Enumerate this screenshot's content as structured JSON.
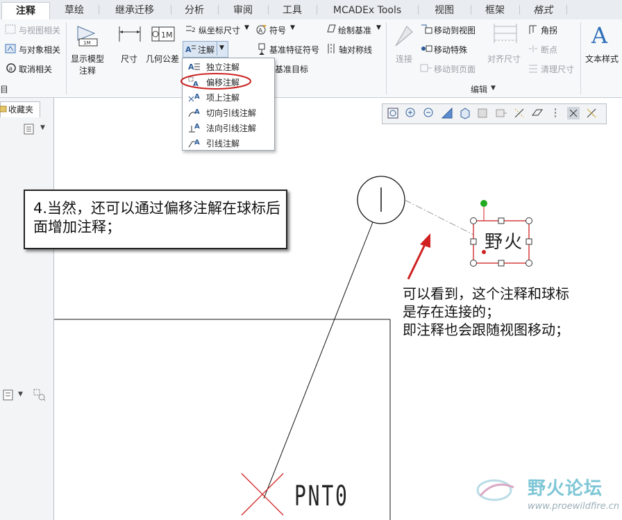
{
  "tabs": [
    "注释",
    "草绘",
    "继承迁移",
    "分析",
    "审阅",
    "工具",
    "MCADEx Tools",
    "视图",
    "框架",
    "格式"
  ],
  "ribbon": {
    "left_col": [
      "与视图相关",
      "与对象相关",
      "取消相关"
    ],
    "show_model": [
      "显示模型",
      "注释"
    ],
    "dimension": "尺寸",
    "geo_tol": "几何公差",
    "ordinate": "纵坐标尺寸",
    "note": "注解",
    "symbol": "符号",
    "datum_feature": "基准特征符号",
    "datum_target": "基准目标",
    "draw_datum": "绘制基准",
    "axis_sym": "轴对称线",
    "connect": "连接",
    "move_to_view": "移动到视图",
    "move_special": "移动特殊",
    "move_to_page": "移动到页面",
    "align_dim": "对齐尺寸",
    "corner": "角拐",
    "break": "断点",
    "cleanup_dim": "清理尺寸",
    "text_style": "文本样式",
    "group_left": "目",
    "group_edit": "编辑"
  },
  "dropdown": [
    "独立注解",
    "偏移注解",
    "项上注解",
    "切向引线注解",
    "法向引线注解",
    "引线注解"
  ],
  "left_panel": {
    "favorites": "收藏夹"
  },
  "canvas": {
    "callout": "4.当然，还可以通过偏移注解在球标后面增加注释；",
    "note_lines": [
      "可以看到，这个注释和球标",
      "是存在连接的；",
      "即注释也会跟随视图移动；"
    ],
    "note_glyph": "野火",
    "pnt_label": "PNT0"
  },
  "watermark": {
    "name": "野火论坛",
    "url": "www.proewildfire.cn"
  },
  "colors": {
    "accent_red": "#cc2222",
    "selection_green": "#22aa22",
    "dropdown_highlight_ring": "#cc2222"
  }
}
